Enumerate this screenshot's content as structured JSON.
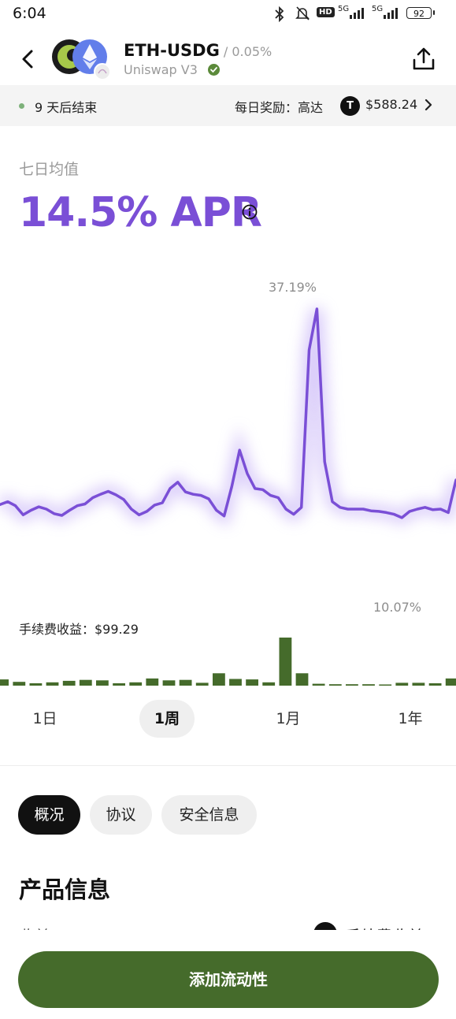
{
  "status_bar": {
    "time": "6:04",
    "hd": "HD",
    "network1": "5G",
    "network2": "5G",
    "battery": "92",
    "icons": [
      "bluetooth-icon",
      "mute-bell-icon"
    ]
  },
  "header": {
    "pair": "ETH-USDG",
    "fee_tier": " / 0.05%",
    "protocol": "Uniswap V3",
    "icons": [
      "back-icon",
      "eth-token-icon",
      "share-icon",
      "verified-icon"
    ]
  },
  "banner": {
    "end_text": "9 天后结束",
    "reward_label": "每日奖励：高达",
    "reward_token_symbol": "T",
    "reward_value": "$588.24"
  },
  "apr": {
    "label": "七日均值",
    "value": "14.5% APR"
  },
  "chart_data": [
    {
      "type": "line",
      "title": "",
      "peak_label": "37.19%",
      "values": [
        3.0,
        3.5,
        2.8,
        1.2,
        2.0,
        2.6,
        2.2,
        1.4,
        1.1,
        2.0,
        2.8,
        3.1,
        4.2,
        4.8,
        5.3,
        4.7,
        3.9,
        2.2,
        1.2,
        1.8,
        2.9,
        3.3,
        5.8,
        6.9,
        5.2,
        4.8,
        4.6,
        4.0,
        2.0,
        1.0,
        6.2,
        12.5,
        8.4,
        5.8,
        5.6,
        4.6,
        4.2,
        2.2,
        1.3,
        2.5,
        30.0,
        37.19,
        10.5,
        3.5,
        2.5,
        2.2,
        2.2,
        2.2,
        1.9,
        1.8,
        1.6,
        1.3,
        0.7,
        1.8,
        2.2,
        2.5,
        2.1,
        2.2,
        1.6,
        7.3
      ],
      "color": "#7a4fd6"
    },
    {
      "type": "bar",
      "title": "手续费收益：$99.29",
      "peak_label": "10.07%",
      "values": [
        1.3,
        0.8,
        0.5,
        0.7,
        1.0,
        1.2,
        1.1,
        0.5,
        0.7,
        1.5,
        1.1,
        1.2,
        0.6,
        2.6,
        1.4,
        1.3,
        0.7,
        10.07,
        2.6,
        0.4,
        0.3,
        0.3,
        0.3,
        0.2,
        0.6,
        0.6,
        0.5,
        1.5
      ],
      "color": "#456b2b"
    }
  ],
  "range_tabs": [
    "1日",
    "1周",
    "1月",
    "1年"
  ],
  "active_range": "1周",
  "section_tabs": [
    "概况",
    "协议",
    "安全信息"
  ],
  "active_section": "概况",
  "product_section": {
    "title": "产品信息",
    "row_label": "收益",
    "row_value": "手续费收益"
  },
  "cta": {
    "label": "添加流动性",
    "color": "#456b2b"
  }
}
